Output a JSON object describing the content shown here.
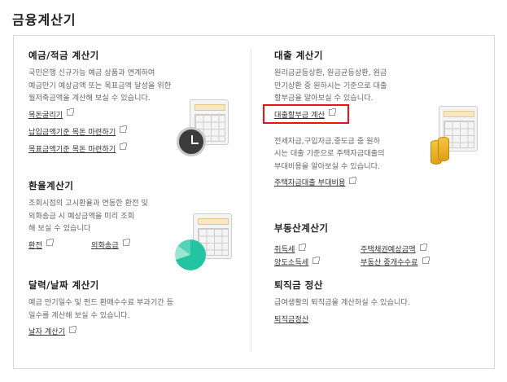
{
  "page": {
    "title": "금융계산기"
  },
  "deposit": {
    "title": "예금/적금 계산기",
    "desc": [
      "국민은행 신규가능 예금 상품과 연계하여",
      "예금만기 예상금액 또는 목표금액 달성을 위한",
      "월저축금액을 계산해 보실 수 있습니다."
    ],
    "links": [
      "목돈굴리기",
      "납입금액기준 목돈 마련하기",
      "목표금액기준 목돈 마련하기"
    ]
  },
  "exchange": {
    "title": "환율계산기",
    "desc": [
      "조회시점의 고시환율과 연동한 환전 및",
      "외화송금 시 예상금액을 미리 조회",
      "해 보실 수 있습니다"
    ],
    "links": [
      "환전",
      "외화송금"
    ]
  },
  "calendar": {
    "title": "달력/날짜 계산기",
    "desc": [
      "예금 만기일수 및 펀드 환매수수료 부과기간 등",
      "일수를 계산해 보실 수 있습니다."
    ],
    "links": [
      "날자 계산기"
    ]
  },
  "loan": {
    "title": "대출 계산기",
    "desc": [
      "원리금균등상환, 원금균등상환, 원금",
      "만기상환 중 원하시는 기준으로 대출",
      "할부금을 알아보실 수 있습니다."
    ],
    "links": [
      "대출할부금 계산"
    ],
    "desc2": [
      "전세자금,구입자금,중도금 중 원하",
      "시는 대출 기준으로 주택자금대출의",
      "부대비용을 알아보실 수 있습니다."
    ],
    "links2": [
      "주택자금대출 부대비용"
    ]
  },
  "realestate": {
    "title": "부동산계산기",
    "links": [
      "취득세",
      "주택채권예상금액",
      "양도소득세",
      "부동산 중개수수료"
    ]
  },
  "severance": {
    "title": "퇴직금 정산",
    "desc": [
      "급여생활의 퇴직금을 계산하실 수 있습니다."
    ],
    "links": [
      "퇴직금정산"
    ]
  },
  "icons": [
    "external-link-icon",
    "calculator-icon",
    "clock-icon",
    "pie-chart-icon",
    "coins-icon"
  ],
  "colors": {
    "highlight": "#e11111",
    "border": "#d9d9d9",
    "text": "#333333"
  }
}
